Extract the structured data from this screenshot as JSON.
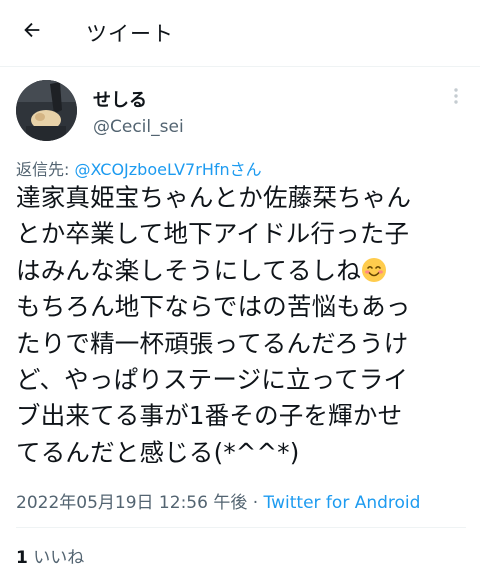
{
  "header": {
    "title": "ツイート",
    "back_icon": "arrow-left-icon"
  },
  "tweet": {
    "author_name": "せしる",
    "author_handle": "@Cecil_sei",
    "reply_prefix": "返信先: ",
    "reply_mention": "@XCOJzboeLV7rHfn",
    "reply_suffix": "さん",
    "body_lines": [
      "達家真姫宝ちゃんとか佐藤栞ちゃん",
      "とか卒業して地下アイドル行った子",
      "はみんな楽しそうにしてるしね",
      "もちろん地下ならではの苦悩もあっ",
      "たりで精一杯頑張ってるんだろうけ",
      "ど、やっぱりステージに立ってライ",
      "ブ出来てる事が1番その子を輝かせ",
      "てるんだと感じる(*^^*)"
    ],
    "emoji": "smiling-face-emoji",
    "timestamp": "2022年05月19日 12:56 午後",
    "separator": " · ",
    "source_app": "Twitter for Android",
    "like_count": "1",
    "like_label": "いいね"
  },
  "colors": {
    "accent": "#1d9bf0",
    "secondary_text": "#536471",
    "primary_text": "#0f1419",
    "divider": "#eff3f4"
  }
}
